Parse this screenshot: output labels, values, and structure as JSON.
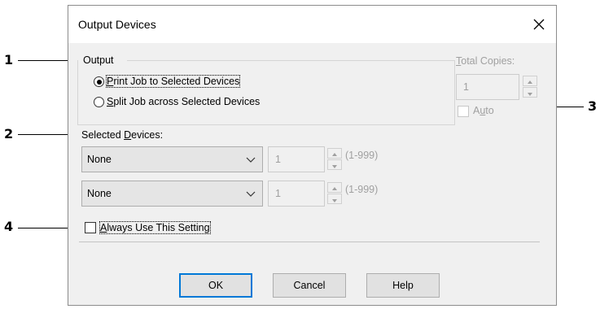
{
  "dialog": {
    "title": "Output Devices",
    "close_symbol": "✕"
  },
  "output": {
    "group_label": "Output",
    "options": [
      {
        "label_mnemonic": "P",
        "label_rest": "rint Job to Selected Devices",
        "selected": true
      },
      {
        "label_mnemonic": "S",
        "label_rest": "plit Job across Selected Devices",
        "selected": false
      }
    ]
  },
  "total_copies": {
    "label_mnemonic": "T",
    "label_rest": "otal Copies:",
    "value": "1",
    "auto_pre": "A",
    "auto_mnemonic": "u",
    "auto_rest": "to",
    "auto_checked": false
  },
  "selected_devices": {
    "label_pre": "Selected ",
    "label_mnemonic": "D",
    "label_rest": "evices:",
    "rows": [
      {
        "device": "None",
        "copies": "1",
        "range": "(1-999)"
      },
      {
        "device": "None",
        "copies": "1",
        "range": "(1-999)"
      }
    ]
  },
  "always_use": {
    "label_mnemonic": "A",
    "label_rest": "lways Use This Setting",
    "checked": false
  },
  "buttons": {
    "ok": "OK",
    "cancel": "Cancel",
    "help": "Help"
  },
  "callouts": [
    "1",
    "2",
    "3",
    "4"
  ],
  "colors": {
    "dialog_bg": "#f0f0f0",
    "default_button_border": "#0078d7",
    "disabled_text": "#a0a0a0"
  },
  "icons": {
    "close": "close-icon",
    "dropdown": "chevron-down-icon",
    "spin_up": "spin-up-icon",
    "spin_down": "spin-down-icon"
  }
}
